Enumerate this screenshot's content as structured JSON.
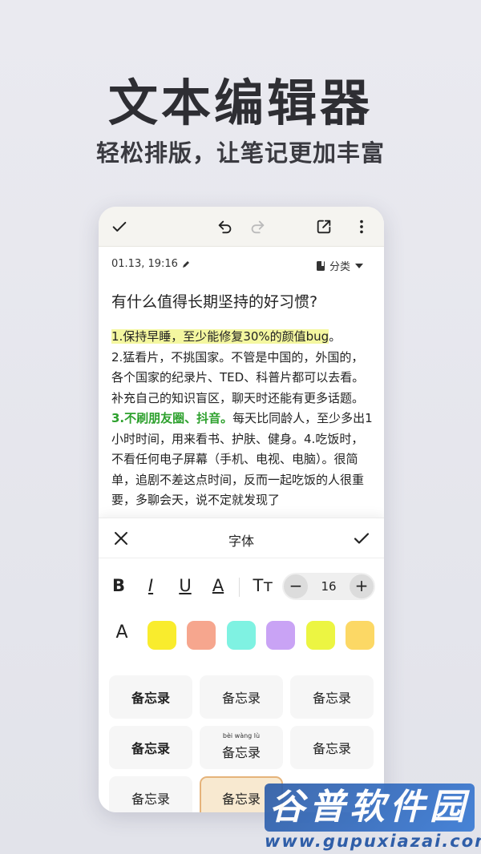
{
  "promo": {
    "headline": "文本编辑器",
    "subheadline": "轻松排版，让笔记更加丰富"
  },
  "toolbar": {
    "icons": [
      "check-icon",
      "undo-icon",
      "redo-icon",
      "share-icon",
      "more-icon"
    ]
  },
  "note": {
    "timestamp": "01.13, 19:16",
    "category_label": "分类",
    "title": "有什么值得长期坚持的好习惯?",
    "para1_highlight": "1.保持早睡，至少能修复30%的颜值bug",
    "para1_end": "。",
    "para2": "2.猛看片，不挑国家。不管是中国的，外国的，各个国家的纪录片、TED、科普片都可以去看。补充自己的知识盲区，聊天时还能有更多话题。",
    "para3_green": "3.不刷朋友圈、抖音。",
    "para3_rest": "每天比同龄人，至少多出1小时时间，用来看书、护肤、健身。4.吃饭时，不看任何电子屏幕（手机、电视、电脑）。很简单，追剧不差这点时间，反而一起吃饭的人很重要，多聊会天，说不定就发现了"
  },
  "font_sheet": {
    "title": "字体",
    "bold_label": "B",
    "italic_label": "I",
    "underline_label": "U",
    "color_label": "A",
    "size_label": "Tт",
    "font_color_label": "A",
    "minus_label": "−",
    "plus_label": "+",
    "font_size": "16",
    "swatch_colors": [
      "#f9ec2d",
      "#f6a68e",
      "#7ff2e2",
      "#c9a3f5",
      "#ecf542",
      "#fcd865"
    ],
    "styles": [
      {
        "label": "备忘录",
        "pinyin": ""
      },
      {
        "label": "备忘录",
        "pinyin": ""
      },
      {
        "label": "备忘录",
        "pinyin": ""
      },
      {
        "label": "备忘录",
        "pinyin": ""
      },
      {
        "label": "备忘录",
        "pinyin": "bèi wàng lù"
      },
      {
        "label": "备忘录",
        "pinyin": ""
      },
      {
        "label": "备忘录",
        "pinyin": ""
      },
      {
        "label": "备忘录",
        "pinyin": ""
      }
    ]
  },
  "watermark": {
    "name": "谷普软件园",
    "url": "www.gupuxiazai.com"
  }
}
